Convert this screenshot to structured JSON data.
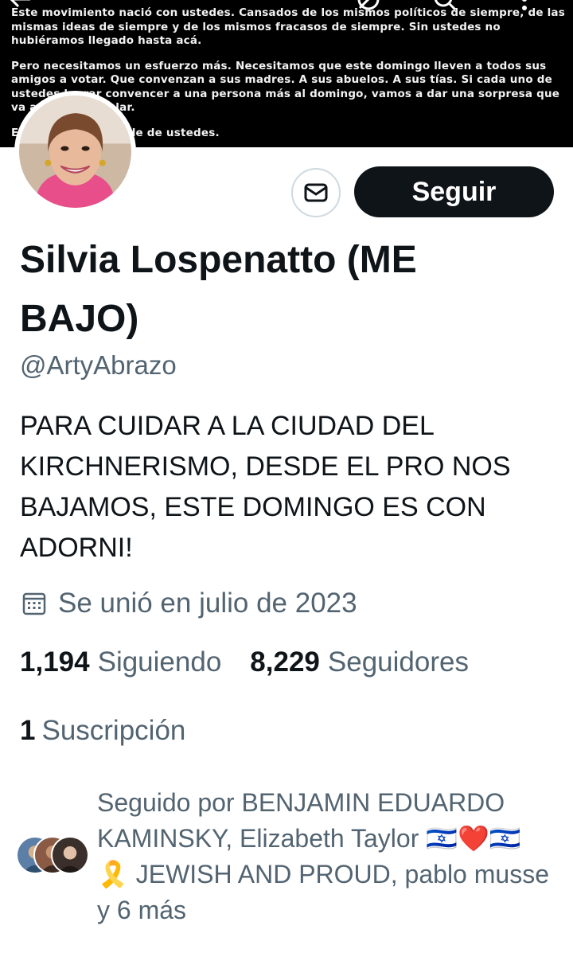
{
  "banner": {
    "paragraph1": "Este movimiento nació con ustedes. Cansados de los mismos políticos de siempre, de las mismas ideas de siempre y de los mismos fracasos de siempre. Sin ustedes no hubiéramos llegado hasta acá.",
    "paragraph2": "Pero necesitamos un esfuerzo más. Necesitamos que este domingo lleven a todos sus amigos a votar. Que convenzan a sus madres. A sus abuelos. A sus tías. Si cada uno de ustedes lograr convencer a una persona más al domingo, vamos a dar una sorpresa que va a dar que hablar.",
    "paragraph3": "El resultado depende de ustedes."
  },
  "header_icons": [
    "back-arrow-icon",
    "hide-icon",
    "search-icon",
    "more-options-icon"
  ],
  "profile": {
    "name": "Silvia Lospenatto (ME BAJO)",
    "handle": "@ArtyAbrazo",
    "bio": "PARA CUIDAR A LA CIUDAD DEL KIRCHNERISMO, DESDE EL PRO NOS BAJAMOS, ESTE DOMINGO ES CON ADORNI!",
    "joined": "Se unió en julio de 2023"
  },
  "actions": {
    "message_icon": "envelope-icon",
    "follow_label": "Seguir"
  },
  "stats": {
    "following_count": "1,194",
    "following_label": "Siguiendo",
    "followers_count": "8,229",
    "followers_label": "Seguidores",
    "subscriptions_count": "1",
    "subscriptions_label": "Suscripción"
  },
  "followed_by": {
    "text": "Seguido por BENJAMIN EDUARDO KAMINSKY, Elizabeth Taylor 🇮🇱❤️🇮🇱 🎗️ JEWISH AND PROUD, pablo musse y 6 más"
  },
  "colors": {
    "text_primary": "#0f1419",
    "text_secondary": "#536471",
    "button_dark": "#0f1419",
    "border": "#cfd9de"
  }
}
